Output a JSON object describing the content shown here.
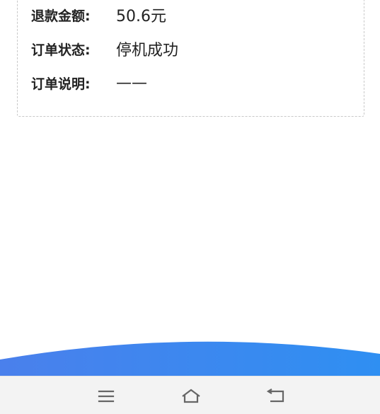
{
  "order": {
    "refund_amount_label": "退款金额:",
    "refund_amount_value": "50.6元",
    "status_label": "订单状态:",
    "status_value": "停机成功",
    "note_label": "订单说明:",
    "note_value": "——"
  },
  "nav_bar": {
    "menu_icon": "menu-icon",
    "home_icon": "home-icon",
    "back_icon": "back-icon"
  },
  "colors": {
    "wave_start": "#4a80ec",
    "wave_end": "#2f8ff2",
    "nav_background": "#f3f3f3",
    "nav_icon": "#666666"
  }
}
